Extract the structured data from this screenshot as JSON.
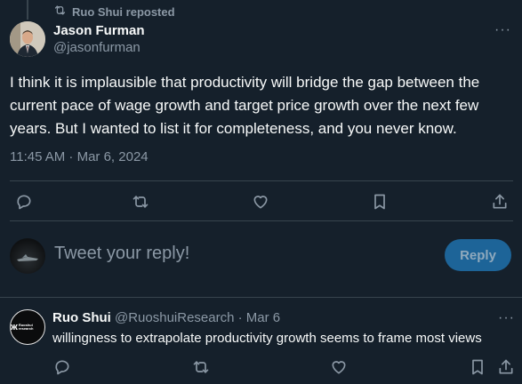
{
  "repost": {
    "label": "Ruo Shui reposted"
  },
  "tweet": {
    "author_name": "Jason Furman",
    "author_handle": "@jasonfurman",
    "text": "I think it is implausible that productivity will bridge the gap between the current pace of wage growth and target price growth over the next few years. But I wanted to list it for completeness, and you never know.",
    "timestamp": "11:45 AM · Mar 6, 2024",
    "more_glyph": "···"
  },
  "reply_composer": {
    "placeholder": "Tweet your reply!",
    "button_label": "Reply"
  },
  "reply": {
    "author_name": "Ruo Shui",
    "meta": "@RuoshuiResearch · Mar 6",
    "text": "willingness to extrapolate productivity growth seems to frame most views",
    "more_glyph": "···",
    "avatar_logo_mark": "ж",
    "avatar_logo_text": "Ruoshui research"
  },
  "icons": [
    "repost-icon",
    "reply-icon",
    "retweet-icon",
    "like-icon",
    "bookmark-icon",
    "share-icon",
    "more-icon"
  ],
  "colors": {
    "background": "#15202b",
    "text": "#f7f9f9",
    "muted": "#8b98a5",
    "divider": "#38444d",
    "reply_button_bg": "#1d6498",
    "reply_button_text": "#8fa9bd"
  }
}
